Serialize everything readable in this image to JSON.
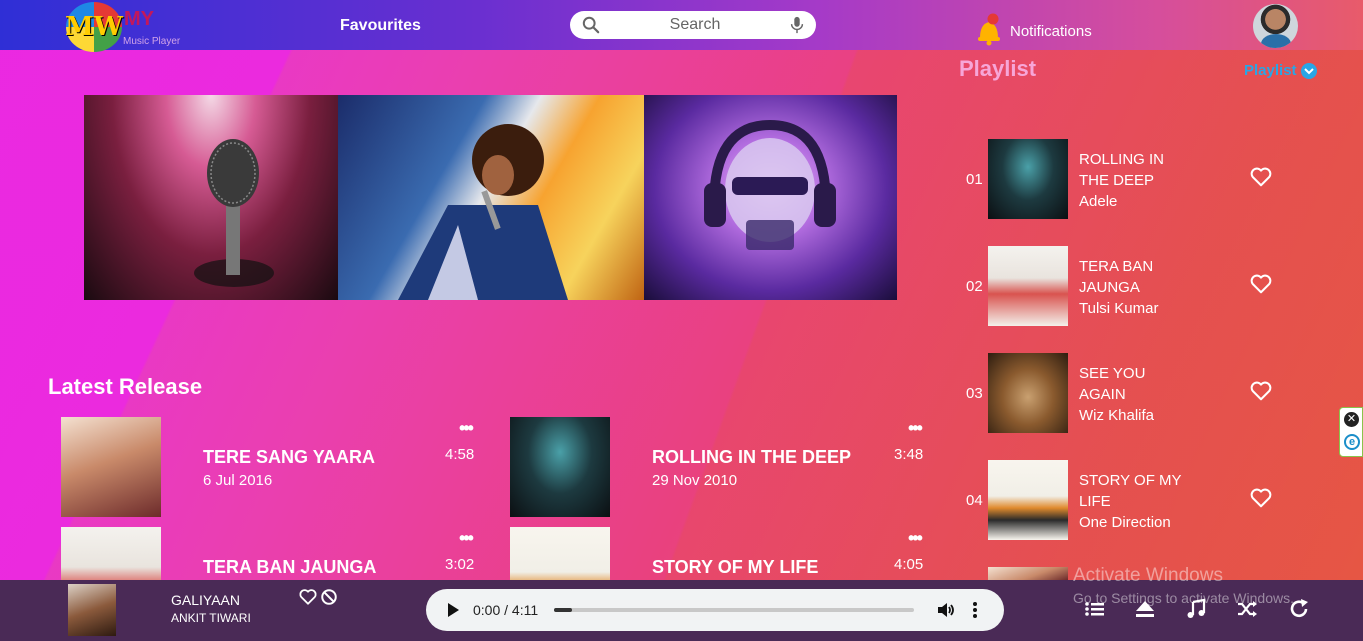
{
  "header": {
    "logo_mark": "MW",
    "logo_title": "MY",
    "logo_subtitle": "Music Player",
    "nav_favourites": "Favourites",
    "search_placeholder": "Search",
    "notifications_label": "Notifications"
  },
  "latest": {
    "title": "Latest Release",
    "items": [
      {
        "title": "TERE SANG YAARA",
        "date": "6 Jul 2016",
        "duration": "4:58",
        "menu": "•••",
        "thumb_color": "#c98a6a"
      },
      {
        "title": "ROLLING IN THE DEEP",
        "date": "29 Nov 2010",
        "duration": "3:48",
        "menu": "•••",
        "thumb_color": "#2a3a3f"
      },
      {
        "title": "TERA BAN JAUNGA",
        "date": "",
        "duration": "3:02",
        "menu": "•••",
        "thumb_color": "#e9e4de"
      },
      {
        "title": "STORY OF MY LIFE",
        "date": "",
        "duration": "4:05",
        "menu": "•••",
        "thumb_color": "#f1efe7"
      }
    ]
  },
  "playlist": {
    "title": "Playlist",
    "link_label": "Playlist",
    "items": [
      {
        "num": "01",
        "name": "ROLLING IN THE DEEP",
        "artist": "Adele",
        "thumb_color": "#2a3a3f"
      },
      {
        "num": "02",
        "name": "TERA BAN JAUNGA",
        "artist": "Tulsi Kumar",
        "thumb_color": "#e9e4de"
      },
      {
        "num": "03",
        "name": "SEE YOU AGAIN",
        "artist": "Wiz Khalifa",
        "thumb_color": "#8a5a2e"
      },
      {
        "num": "04",
        "name": "STORY OF MY LIFE",
        "artist": "One Direction",
        "thumb_color": "#f1efe7"
      }
    ]
  },
  "player": {
    "now_title": "GALIYAAN",
    "now_artist": "ANKIT TIWARI",
    "time": "0:00 / 4:11",
    "progress": 0.05
  },
  "banner": {
    "images": [
      "microphone-crowd",
      "singer-performing",
      "skull-headphones"
    ]
  },
  "watermark": {
    "line1": "Activate Windows",
    "line2": "Go to Settings to activate Windows."
  },
  "side_widget": {
    "close": "✕",
    "edge": "e"
  }
}
